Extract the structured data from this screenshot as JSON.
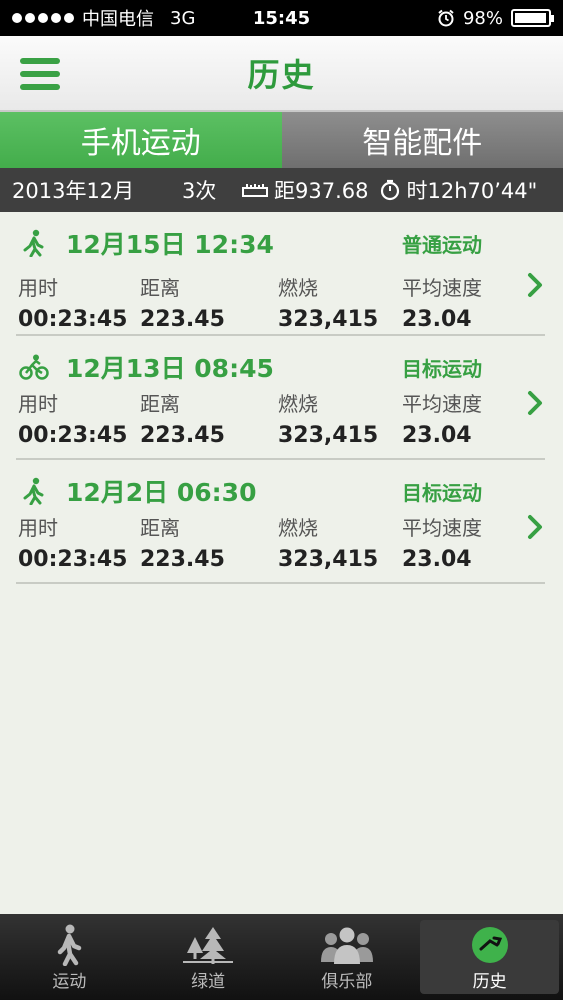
{
  "status_bar": {
    "carrier": "中国电信",
    "network": "3G",
    "time": "15:45",
    "battery_percent": "98%",
    "battery_level": 0.98
  },
  "header": {
    "title": "历史",
    "menu_icon": "hamburger-menu-icon"
  },
  "segments": {
    "phone": "手机运动",
    "accessory": "智能配件",
    "active": "phone"
  },
  "summary": {
    "month": "2013年12月",
    "count": "3次",
    "distance": "距937.68",
    "duration": "时12h70’44\""
  },
  "colors": {
    "accent": "#37a043",
    "segment_active": "#4cb554",
    "segment_inactive": "#7d7d7d",
    "summary_bg": "#3f3f3f"
  },
  "labels": {
    "duration": "用时",
    "distance": "距离",
    "calories": "燃烧",
    "avg_speed": "平均速度"
  },
  "records": [
    {
      "icon": "walking-icon",
      "date": "12月15日 12:34",
      "type": "普通运动",
      "duration": "00:23:45",
      "distance": "223.45",
      "calories": "323,415",
      "avg_speed": "23.04"
    },
    {
      "icon": "cycling-icon",
      "date": "12月13日 08:45",
      "type": "目标运动",
      "duration": "00:23:45",
      "distance": "223.45",
      "calories": "323,415",
      "avg_speed": "23.04"
    },
    {
      "icon": "walking-icon",
      "date": "12月2日 06:30",
      "type": "目标运动",
      "duration": "00:23:45",
      "distance": "223.45",
      "calories": "323,415",
      "avg_speed": "23.04"
    }
  ],
  "tabs": [
    {
      "label": "运动",
      "icon": "walking-person-icon"
    },
    {
      "label": "绿道",
      "icon": "trees-icon"
    },
    {
      "label": "俱乐部",
      "icon": "group-icon"
    },
    {
      "label": "历史",
      "icon": "history-icon",
      "active": true
    }
  ]
}
